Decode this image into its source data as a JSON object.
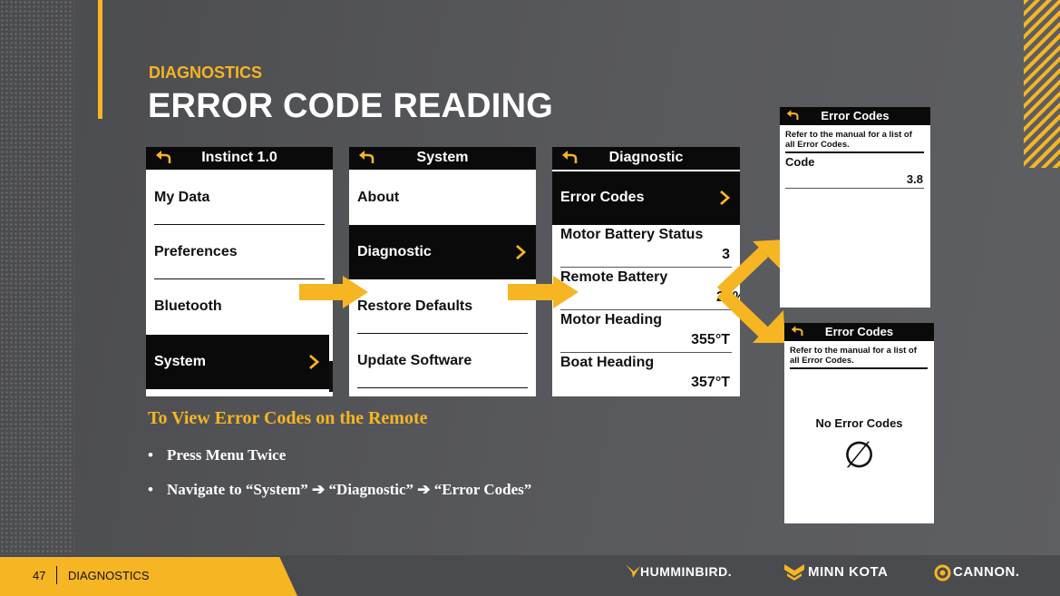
{
  "slide": {
    "kicker": "DIAGNOSTICS",
    "title": "ERROR CODE READING",
    "accent_color": "#f6b522"
  },
  "screens": [
    {
      "header": "Instinct 1.0",
      "items": [
        {
          "label": "My Data",
          "selected": false
        },
        {
          "label": "Preferences",
          "selected": false
        },
        {
          "label": "Bluetooth",
          "selected": false
        },
        {
          "label": "System",
          "selected": true
        }
      ]
    },
    {
      "header": "System",
      "items": [
        {
          "label": "About",
          "selected": false
        },
        {
          "label": "Diagnostic",
          "selected": true
        },
        {
          "label": "Restore Defaults",
          "selected": false
        },
        {
          "label": "Update Software",
          "selected": false
        }
      ]
    },
    {
      "header": "Diagnostic",
      "items": [
        {
          "label": "Error Codes",
          "selected": true
        },
        {
          "label": "Motor Battery Status",
          "value": "3"
        },
        {
          "label": "Remote Battery",
          "value": "20%"
        },
        {
          "label": "Motor Heading",
          "value": "355°T"
        },
        {
          "label": "Boat Heading",
          "value": "357°T"
        }
      ]
    }
  ],
  "error_screens": [
    {
      "header": "Error Codes",
      "note": "Refer to the manual for a list of all Error Codes.",
      "code_label": "Code",
      "code_value": "3.8"
    },
    {
      "header": "Error Codes",
      "note": "Refer to the manual for a list of all Error Codes.",
      "empty_label": "No Error Codes",
      "empty_symbol": "∅"
    }
  ],
  "instructions": {
    "caption": "To View Error Codes on the Remote",
    "bullets": [
      "Press Menu Twice",
      "Navigate to “System” ➔ “Diagnostic” ➔ “Error Codes”"
    ]
  },
  "footer": {
    "page_number": "47",
    "section": "DIAGNOSTICS",
    "brands": [
      "HUMMINBIRD.",
      "MINN KOTA",
      "CANNON."
    ]
  }
}
